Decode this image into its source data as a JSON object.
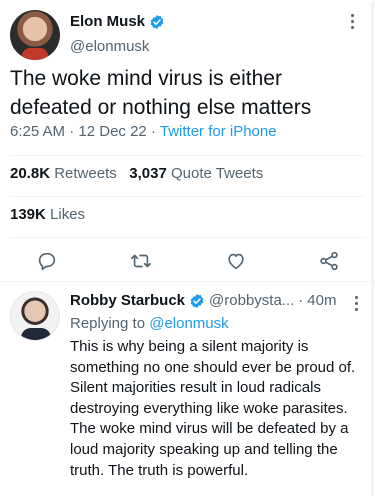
{
  "main_tweet": {
    "author_name": "Elon Musk",
    "author_handle": "@elonmusk",
    "text": "The woke mind virus is either defeated or nothing else matters",
    "time": "6:25 AM",
    "date": "12 Dec 22",
    "source": "Twitter for iPhone",
    "retweets_count": "20.8K",
    "retweets_label": "Retweets",
    "quotes_count": "3,037",
    "quotes_label": "Quote Tweets",
    "likes_count": "139K",
    "likes_label": "Likes"
  },
  "reply": {
    "author_name": "Robby Starbuck",
    "author_handle": "@robbysta...",
    "time": "40m",
    "replying_label": "Replying to",
    "replying_to": "@elonmusk",
    "text": "This is why being a silent majority is something no one should ever be proud of. Silent majorities result in loud radicals destroying everything like woke parasites. The woke mind virus will be defeated by a loud majority speaking up and telling the truth. The truth is powerful."
  },
  "colors": {
    "accent": "#1d9bf0",
    "secondary_text": "#536471",
    "primary_text": "#0f1419",
    "divider": "#eff3f4"
  },
  "icons": [
    "verified-badge-icon",
    "more-options-icon",
    "reply-icon",
    "retweet-icon",
    "like-icon",
    "share-icon"
  ]
}
